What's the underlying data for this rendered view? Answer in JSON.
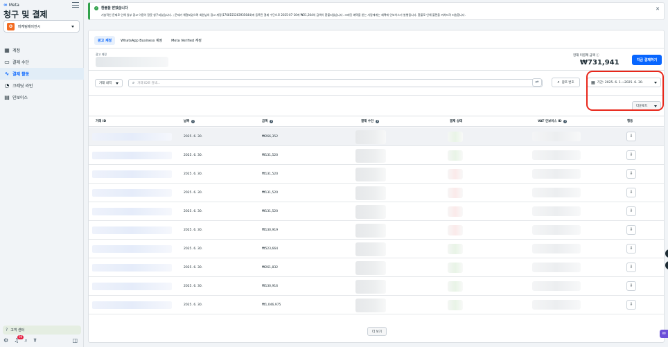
{
  "sidebar": {
    "brand": "Meta",
    "title": "청구 및 결제",
    "account": {
      "avatar_letter": "O",
      "name": "마케팅에이전시"
    },
    "nav": [
      {
        "label": "계정",
        "icon": "accounts-icon",
        "glyph": "▦"
      },
      {
        "label": "결제 수단",
        "icon": "card-icon",
        "glyph": "▭"
      },
      {
        "label": "결제 활동",
        "icon": "activity-icon",
        "glyph": "∿"
      },
      {
        "label": "크레딧 라인",
        "icon": "credit-line-icon",
        "glyph": "◔"
      },
      {
        "label": "인보이스",
        "icon": "invoice-icon",
        "glyph": "▤"
      }
    ],
    "help_label": "고객 센터",
    "notification_count": "99"
  },
  "banner": {
    "title": "환불을 받았습니다",
    "body": "기술적인 문제로 인해 일부 광고 이용이 잘못 청구되었습니다. ; 문제가 해결되었으며 회원님의 광고 계정(1768155263935644)에 등록된 결제 수단으로 2025-07-10에 ₩21,304의 금액이 환불되었습니다. 크레딧 혜택을 받는 사람에게는 혜택에 인보이스가 발행됩니다. 환불로 인해 불편을 끼쳐드려 죄송합니다."
  },
  "tabs": [
    "광고 계정",
    "WhatsApp Business 계정",
    "Meta Verified 계정"
  ],
  "account_section": {
    "label": "광고 계정",
    "balance_label": "현재 미결제 금액",
    "balance_value": "₩731,941",
    "pay_now_label": "지금 결제하기"
  },
  "filters": {
    "transaction_type": "거래 내역",
    "search_placeholder": "거래 ID로 검색...",
    "reference_label": "참조 번호",
    "date_range": "기간: 2025. 6. 1.~2025. 6. 30.",
    "download_label": "다운로드"
  },
  "table": {
    "columns": [
      "거래 ID",
      "날짜",
      "금액",
      "결제 수단",
      "결제 상태",
      "VAT 인보이스 ID",
      "행동"
    ],
    "rows": [
      {
        "date": "2025. 6. 30.",
        "amount": "₩266,352",
        "status": "green"
      },
      {
        "date": "2025. 6. 30.",
        "amount": "₩131,520",
        "status": "green"
      },
      {
        "date": "2025. 6. 30.",
        "amount": "₩131,520",
        "status": "red"
      },
      {
        "date": "2025. 6. 30.",
        "amount": "₩131,520",
        "status": "red"
      },
      {
        "date": "2025. 6. 30.",
        "amount": "₩131,520",
        "status": "red"
      },
      {
        "date": "2025. 6. 30.",
        "amount": "₩130,919",
        "status": "red"
      },
      {
        "date": "2025. 6. 30.",
        "amount": "₩523,664",
        "status": "green"
      },
      {
        "date": "2025. 6. 30.",
        "amount": "₩261,832",
        "status": "green"
      },
      {
        "date": "2025. 6. 30.",
        "amount": "₩130,916",
        "status": "green"
      },
      {
        "date": "2025. 6. 30.",
        "amount": "₩1,046,975",
        "status": "green"
      }
    ],
    "more_label": "더 보기"
  },
  "colors": {
    "accent": "#0866ff",
    "success": "#31a24c",
    "highlight": "#e8261a"
  }
}
